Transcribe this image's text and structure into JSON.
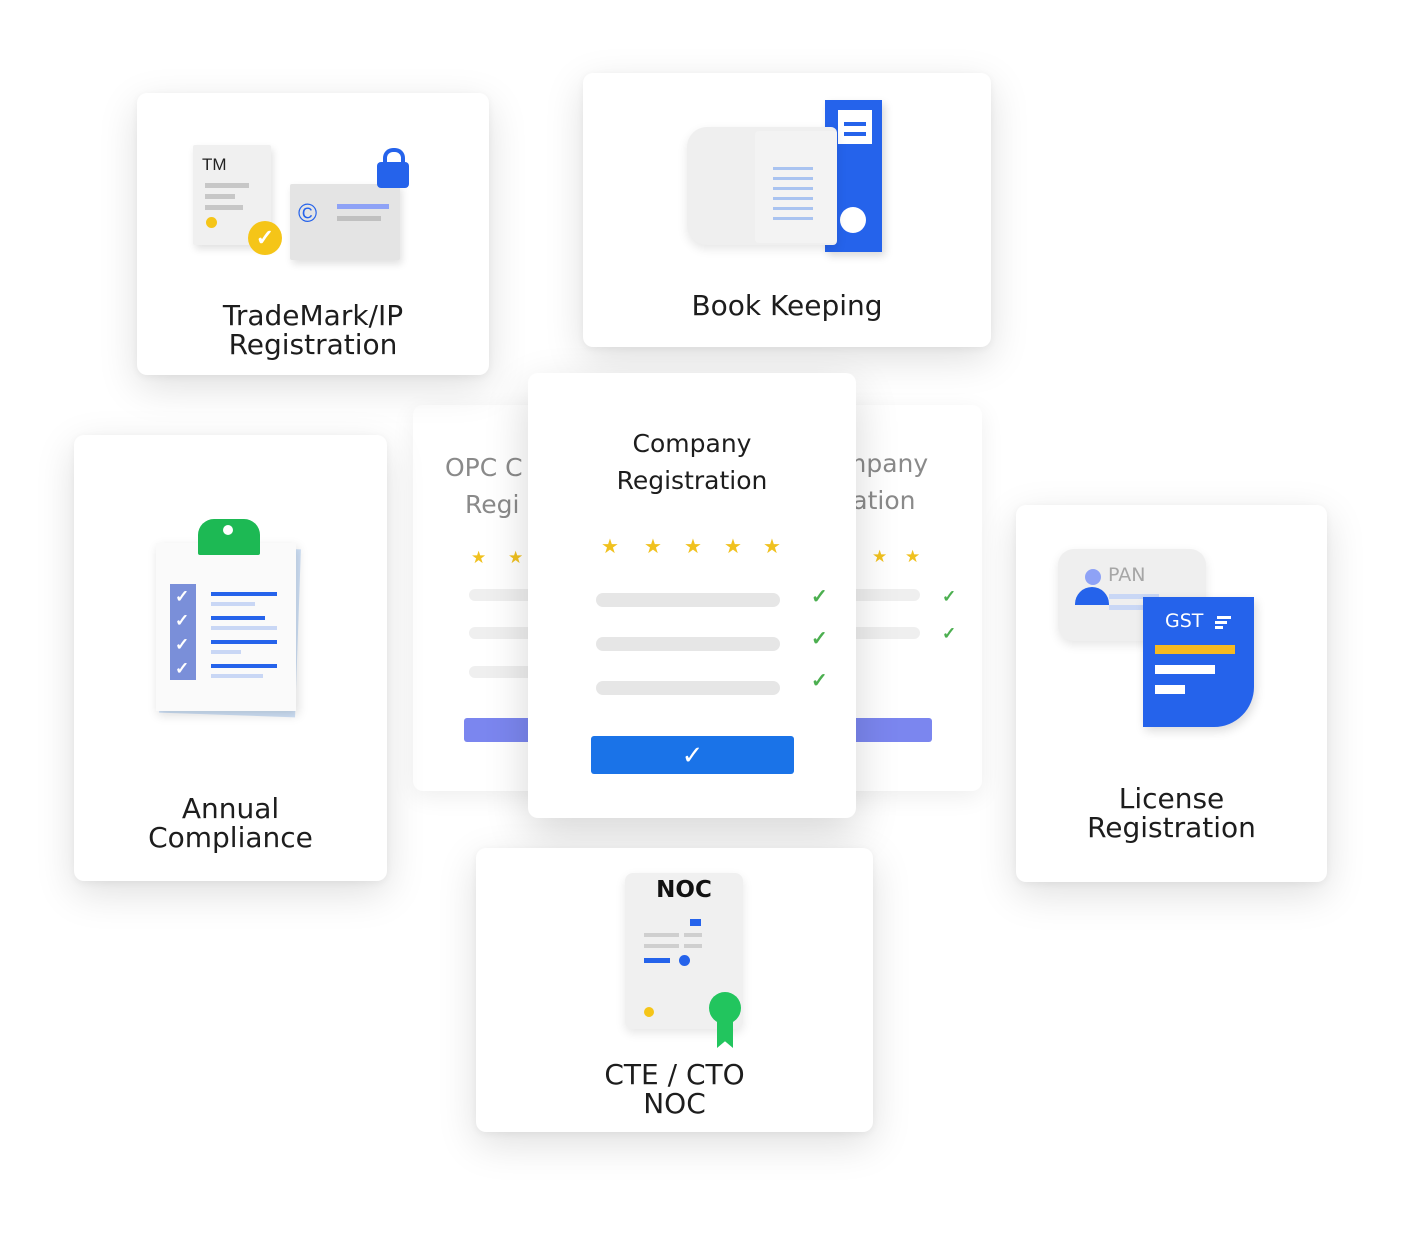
{
  "cards": {
    "trademark": {
      "title_line1": "TradeMark/IP",
      "title_line2": "Registration",
      "doc_label": "TM",
      "copyright_symbol": "©"
    },
    "bookkeeping": {
      "title": "Book Keeping"
    },
    "annual": {
      "title_line1": "Annual",
      "title_line2": "Compliance"
    },
    "company": {
      "title_line1": "Company",
      "title_line2": "Registration",
      "rating_stars": 5,
      "button_check": "✓"
    },
    "opc": {
      "title_line1": "OPC C",
      "title_line2": "Regi"
    },
    "other_company": {
      "title_line1": "mpany",
      "title_line2": "ration"
    },
    "license": {
      "title_line1": "License",
      "title_line2": "Registration",
      "pan_label": "PAN",
      "gst_label": "GST"
    },
    "cte": {
      "title_line1": "CTE / CTO",
      "title_line2": "NOC",
      "doc_label": "NOC"
    }
  },
  "colors": {
    "brand_blue": "#2563eb",
    "button_blue": "#1a73e8",
    "faded_purple": "#7b86ef",
    "star_yellow": "#f0c11f",
    "check_green": "#4caf50",
    "clip_green": "#1db954",
    "ribbon_green": "#22c55e",
    "gst_yellow": "#f5b921"
  }
}
